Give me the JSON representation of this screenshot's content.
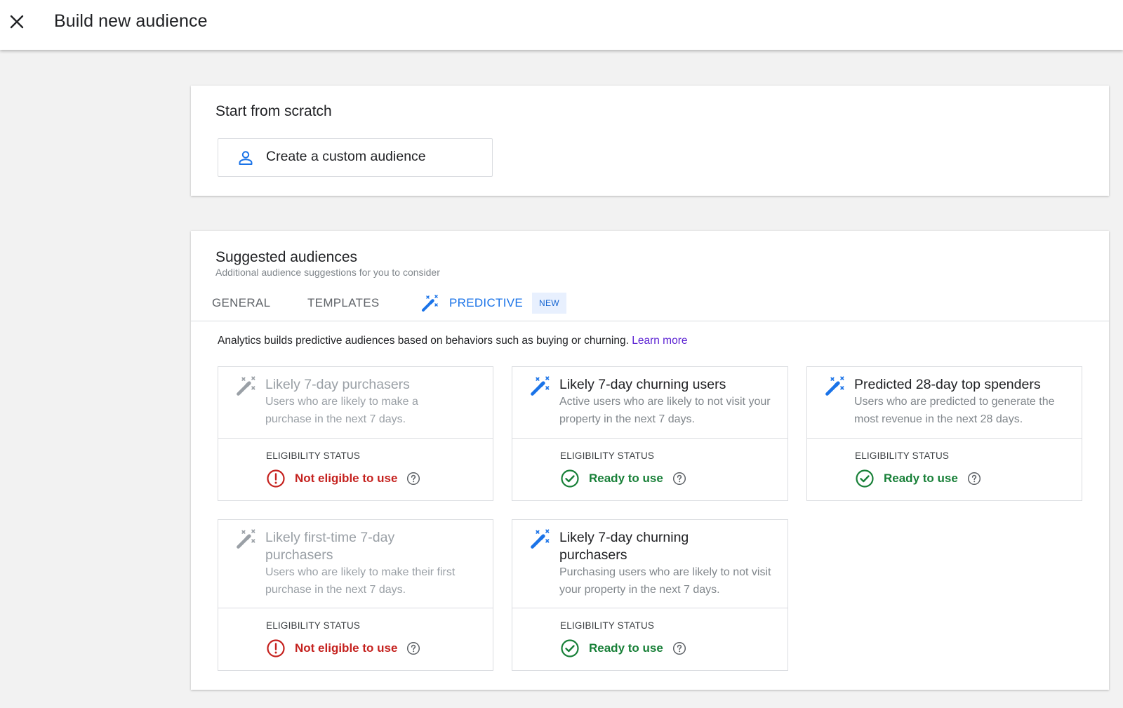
{
  "header": {
    "title": "Build new audience"
  },
  "scratch": {
    "title": "Start from scratch",
    "custom_button_label": "Create a custom audience"
  },
  "suggested": {
    "title": "Suggested audiences",
    "subtitle": "Additional audience suggestions for you to consider",
    "tabs": [
      {
        "label": "GENERAL"
      },
      {
        "label": "TEMPLATES"
      },
      {
        "label": "PREDICTIVE",
        "badge": "NEW"
      }
    ],
    "description": "Analytics builds predictive audiences based on behaviors such as buying or churning.",
    "learn_more": "Learn more",
    "cards": [
      {
        "name": "Likely 7-day purchasers",
        "description": "Users who are likely to make a purchase in the next 7 days.",
        "eligibility_label": "ELIGIBILITY STATUS",
        "status": "Not eligible to use"
      },
      {
        "name": "Likely 7-day churning users",
        "description": "Active users who are likely to not visit your property in the next 7 days.",
        "eligibility_label": "ELIGIBILITY STATUS",
        "status": "Ready to use"
      },
      {
        "name": "Predicted 28-day top spenders",
        "description": "Users who are predicted to generate the most revenue in the next 28 days.",
        "eligibility_label": "ELIGIBILITY STATUS",
        "status": "Ready to use"
      },
      {
        "name": "Likely first-time 7-day purchasers",
        "description": "Users who are likely to make their first purchase in the next 7 days.",
        "eligibility_label": "ELIGIBILITY STATUS",
        "status": "Not eligible to use"
      },
      {
        "name": "Likely 7-day churning purchasers",
        "description": "Purchasing users who are likely to not visit your property in the next 7 days.",
        "eligibility_label": "ELIGIBILITY STATUS",
        "status": "Ready to use"
      }
    ]
  },
  "colors": {
    "accent": "#1a73e8",
    "error": "#c5221f",
    "success": "#188038",
    "link": "#5b21d3"
  },
  "icons": {
    "close": "close-icon",
    "person": "person-icon",
    "wand": "magic-wand-icon",
    "error": "error-circle-icon",
    "success": "check-circle-icon",
    "help": "help-icon"
  }
}
